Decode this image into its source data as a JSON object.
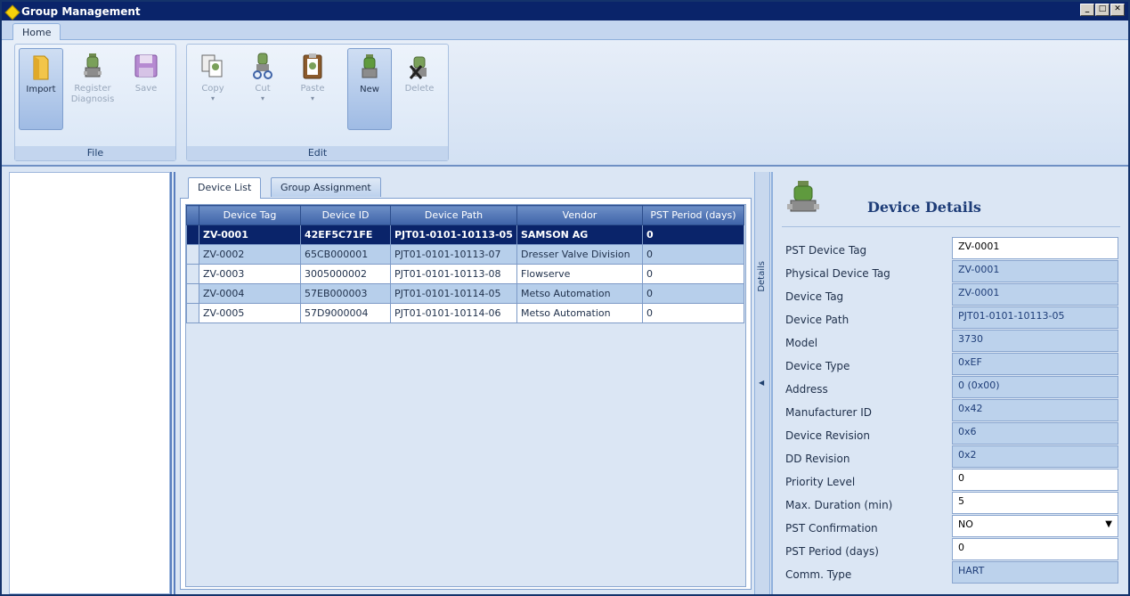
{
  "window": {
    "title": "Group Management",
    "controls": [
      "_",
      "□",
      "✕"
    ]
  },
  "ribbon": {
    "tab": "Home",
    "groups": [
      {
        "label": "File",
        "buttons": [
          {
            "label": "Import",
            "icon": "folder-icon",
            "enabled": true
          },
          {
            "label": "Register Diagnosis",
            "label_lines": [
              "Register",
              "Diagnosis"
            ],
            "icon": "register-diagnosis-icon",
            "enabled": false
          },
          {
            "label": "Save",
            "icon": "save-icon",
            "enabled": false
          }
        ]
      },
      {
        "label": "Edit",
        "buttons": [
          {
            "label": "Copy",
            "icon": "copy-icon",
            "enabled": false
          },
          {
            "label": "Cut",
            "icon": "cut-icon",
            "enabled": false
          },
          {
            "label": "Paste",
            "icon": "paste-icon",
            "enabled": false
          },
          {
            "label": "New",
            "icon": "new-device-icon",
            "enabled": true
          },
          {
            "label": "Delete",
            "icon": "delete-device-icon",
            "enabled": false
          }
        ]
      }
    ]
  },
  "tabs": [
    {
      "label": "Device List",
      "selected": true
    },
    {
      "label": "Group Assignment",
      "selected": false
    }
  ],
  "device_table": {
    "columns": [
      "Device Tag",
      "Device ID",
      "Device Path",
      "Vendor",
      "PST Period (days)"
    ],
    "rows": [
      [
        "ZV-0001",
        "42EF5C71FE",
        "PJT01-0101-10113-05",
        "SAMSON AG",
        "0"
      ],
      [
        "ZV-0002",
        "65CB000001",
        "PJT01-0101-10113-07",
        "Dresser Valve Division",
        "0"
      ],
      [
        "ZV-0003",
        "3005000002",
        "PJT01-0101-10113-08",
        "Flowserve",
        "0"
      ],
      [
        "ZV-0004",
        "57EB000003",
        "PJT01-0101-10114-05",
        "Metso Automation",
        "0"
      ],
      [
        "ZV-0005",
        "57D9000004",
        "PJT01-0101-10114-06",
        "Metso Automation",
        "0"
      ]
    ],
    "selected_row": 0
  },
  "splitter": {
    "label": "Details"
  },
  "details": {
    "title": "Device Details",
    "fields": [
      {
        "label": "PST Device Tag",
        "value": "ZV-0001",
        "kind": "rw"
      },
      {
        "label": "Physical Device Tag",
        "value": "ZV-0001",
        "kind": "ro"
      },
      {
        "label": "Device Tag",
        "value": "ZV-0001",
        "kind": "ro"
      },
      {
        "label": "Device Path",
        "value": "PJT01-0101-10113-05",
        "kind": "ro"
      },
      {
        "label": "Model",
        "value": "3730",
        "kind": "ro"
      },
      {
        "label": "Device Type",
        "value": "0xEF",
        "kind": "ro"
      },
      {
        "label": "Address",
        "value": "0 (0x00)",
        "kind": "ro"
      },
      {
        "label": "Manufacturer ID",
        "value": "0x42",
        "kind": "ro"
      },
      {
        "label": "Device Revision",
        "value": "0x6",
        "kind": "ro"
      },
      {
        "label": "DD Revision",
        "value": "0x2",
        "kind": "ro"
      },
      {
        "label": "Priority Level",
        "value": "0",
        "kind": "rw"
      },
      {
        "label": "Max. Duration (min)",
        "value": "5",
        "kind": "rw"
      },
      {
        "label": "PST Confirmation",
        "value": "NO",
        "kind": "dd"
      },
      {
        "label": "PST Period (days)",
        "value": "0",
        "kind": "rw"
      },
      {
        "label": "Comm. Type",
        "value": "HART",
        "kind": "ro"
      }
    ]
  },
  "colors": {
    "titlebar": "#0a246a",
    "selected_row": "#0a246a",
    "alt_row": "#b7cfeb",
    "readonly_field": "#bcd2ec"
  }
}
